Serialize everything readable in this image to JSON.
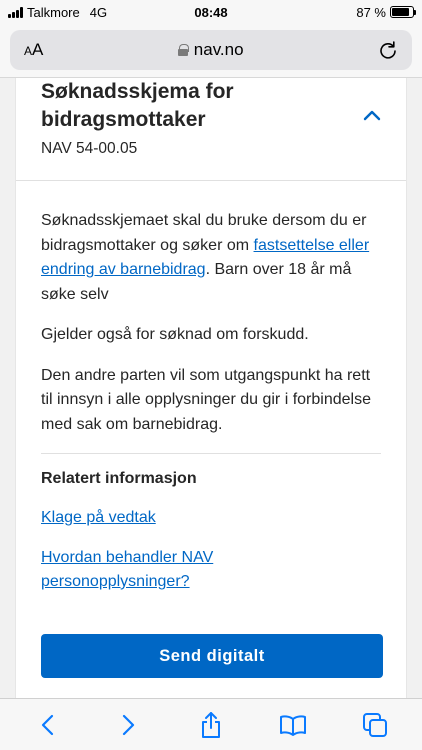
{
  "status_bar": {
    "carrier": "Talkmore",
    "network": "4G",
    "time": "08:48",
    "battery": "87 %",
    "battery_level": 0.87
  },
  "browser": {
    "text_size_label": "AA",
    "url": "nav.no"
  },
  "form": {
    "title": "Søknadsskjema for bidragsmottaker",
    "number": "NAV 54-00.05",
    "expanded": true,
    "description_before_link": "Søknadsskjemaet skal du bruke dersom du er bidragsmottaker og søker om ",
    "description_link": "fastsettelse eller endring av barnebidrag",
    "description_after_link": ". Barn over 18 år må søke selv",
    "paragraph_2": "Gjelder også for søknad om forskudd.",
    "paragraph_3": "Den andre parten vil som utgangspunkt ha rett til innsyn i alle opplysninger du gir i forbindelse med sak om barnebidrag."
  },
  "related": {
    "title": "Relatert informasjon",
    "links": [
      "Klage på vedtak",
      "Hvordan behandler NAV personopplysninger?"
    ]
  },
  "actions": {
    "send_digital": "Send digitalt"
  },
  "toolbar": {
    "icons": [
      "back-icon",
      "forward-icon",
      "share-icon",
      "bookmarks-icon",
      "tabs-icon"
    ]
  },
  "colors": {
    "link": "#0067c5",
    "button": "#0067c5",
    "text": "#262626"
  }
}
